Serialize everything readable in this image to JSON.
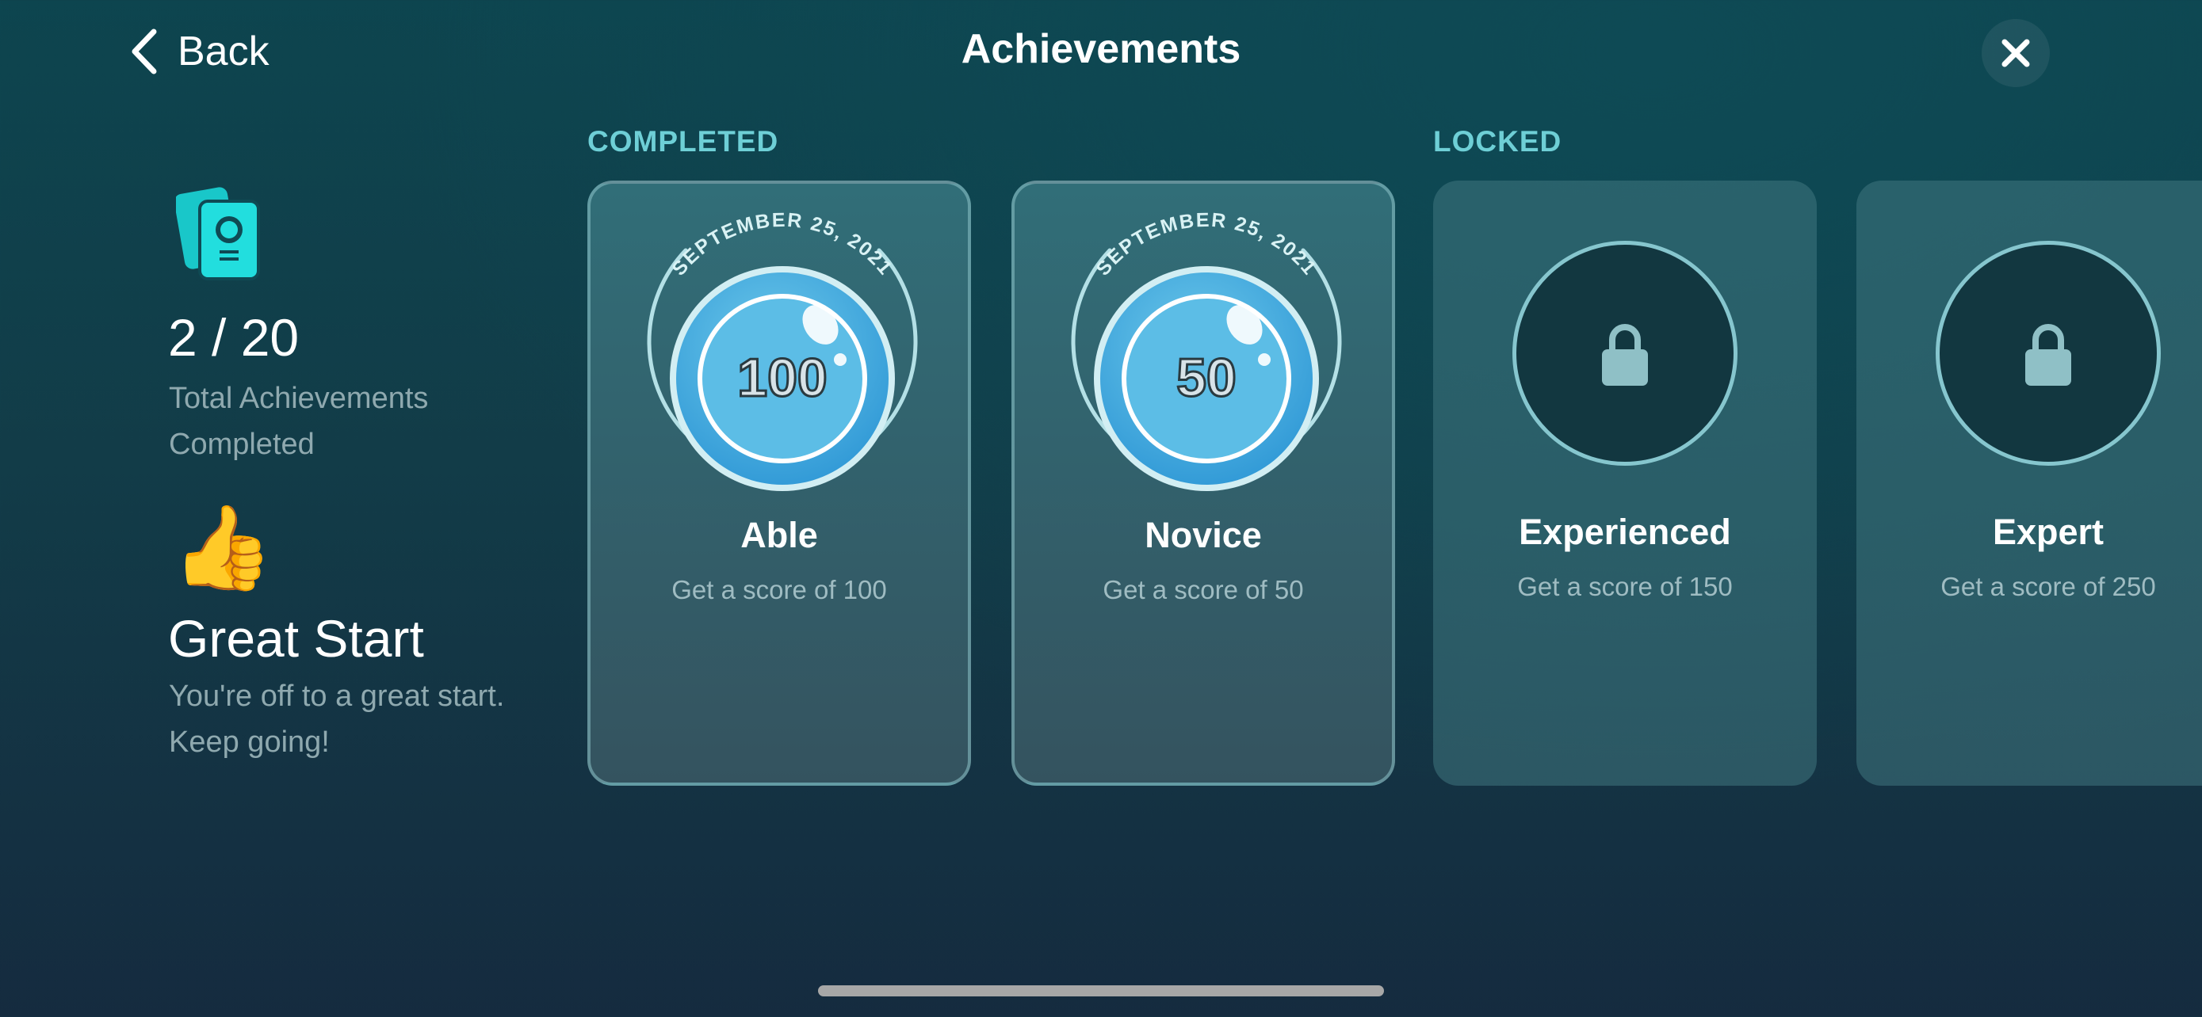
{
  "header": {
    "back_label": "Back",
    "title": "Achievements",
    "close_icon": "close-icon"
  },
  "summary": {
    "icon": "achievement-cards-icon",
    "count": "2 / 20",
    "count_label": "Total Achievements Completed",
    "status_icon": "👍",
    "status_title": "Great Start",
    "status_description": "You're off to a great start. Keep going!"
  },
  "sections": {
    "completed": "COMPLETED",
    "locked": "LOCKED"
  },
  "achievements": [
    {
      "name": "Able",
      "description": "Get a score of 100",
      "badge_value": "100",
      "date": "SEPTEMBER 25, 2021",
      "status": "completed"
    },
    {
      "name": "Novice",
      "description": "Get a score of 50",
      "badge_value": "50",
      "date": "SEPTEMBER 25, 2021",
      "status": "completed"
    },
    {
      "name": "Experienced",
      "description": "Get a score of 150",
      "status": "locked",
      "icon": "lock-icon"
    },
    {
      "name": "Expert",
      "description": "Get a score of 250",
      "status": "locked",
      "icon": "lock-icon"
    }
  ],
  "colors": {
    "accent": "#6ecfd6",
    "badge_blue": "#3fa9de",
    "icon_teal": "#1ed6d6"
  }
}
